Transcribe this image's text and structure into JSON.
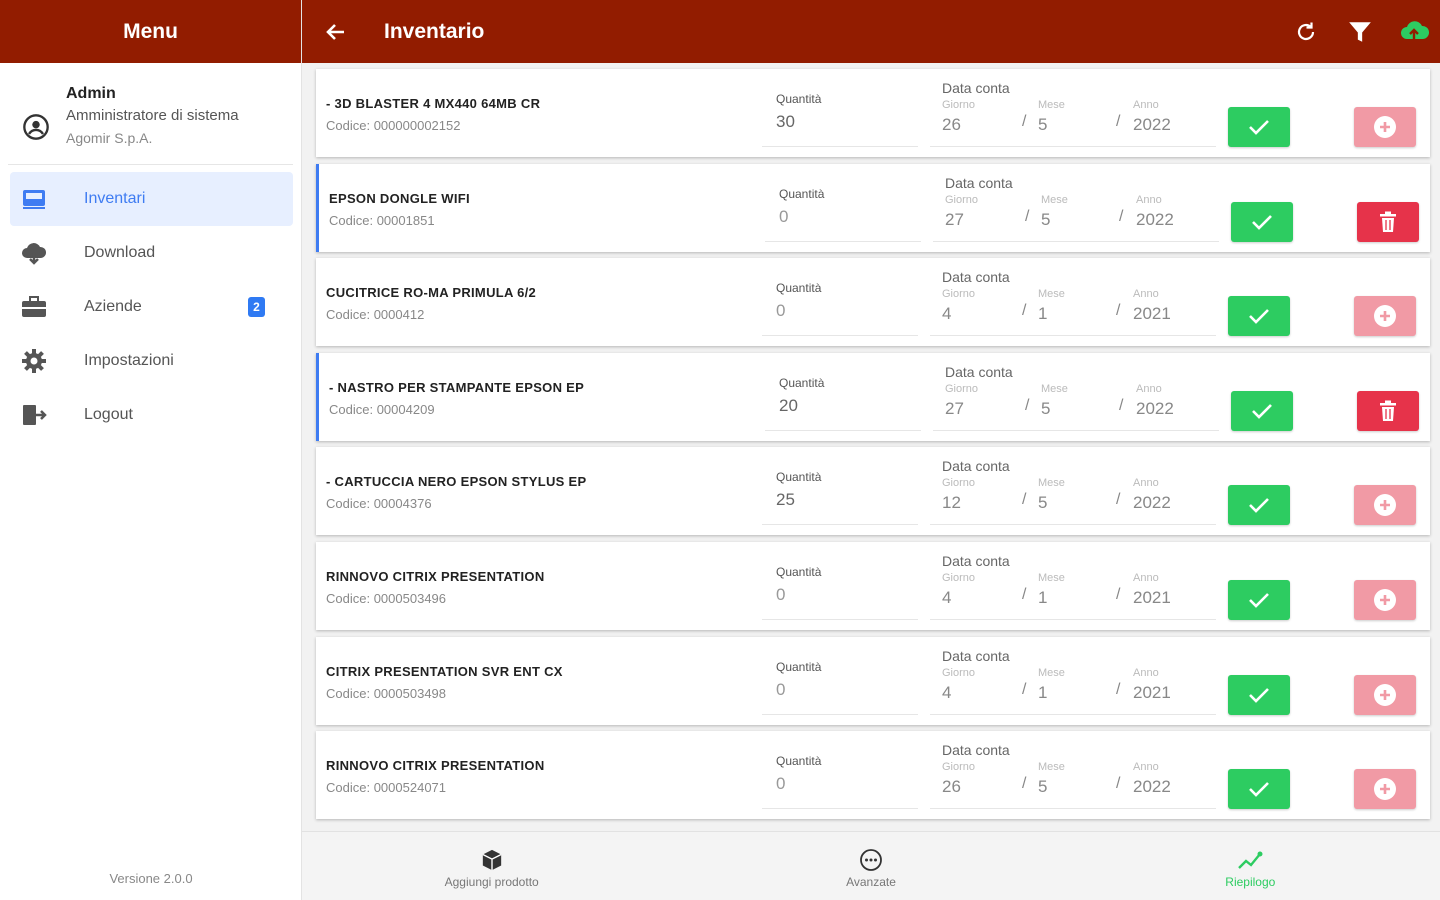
{
  "sidebar": {
    "title": "Menu",
    "profile": {
      "name": "Admin",
      "role": "Amministratore di sistema",
      "company": "Agomir S.p.A."
    },
    "items": [
      {
        "label": "Inventari",
        "icon": "inventory-icon",
        "active": true
      },
      {
        "label": "Download",
        "icon": "cloud-download-icon"
      },
      {
        "label": "Aziende",
        "icon": "briefcase-icon",
        "badge": "2"
      },
      {
        "label": "Impostazioni",
        "icon": "gear-icon"
      },
      {
        "label": "Logout",
        "icon": "logout-icon"
      }
    ],
    "version": "Versione 2.0.0"
  },
  "topbar": {
    "title": "Inventario",
    "actions": [
      "refresh-icon",
      "filter-icon",
      "cloud-upload-icon"
    ]
  },
  "labels": {
    "quantity": "Quantità",
    "date_title": "Data conta",
    "day": "Giorno",
    "month": "Mese",
    "year": "Anno",
    "code_prefix": "Codice:"
  },
  "items": [
    {
      "name": "- 3D BLASTER 4 MX440 64MB CR",
      "code": "000000002152",
      "qty": "30",
      "day": "26",
      "month": "5",
      "year": "2022",
      "marked": false,
      "delete_enabled": false
    },
    {
      "name": "EPSON DONGLE WIFI",
      "code": "00001851",
      "qty": "0",
      "day": "27",
      "month": "5",
      "year": "2022",
      "marked": true,
      "delete_enabled": true
    },
    {
      "name": "CUCITRICE RO-MA PRIMULA 6/2",
      "code": "0000412",
      "qty": "0",
      "day": "4",
      "month": "1",
      "year": "2021",
      "marked": false,
      "delete_enabled": false
    },
    {
      "name": "- NASTRO PER STAMPANTE EPSON EP",
      "code": "00004209",
      "qty": "20",
      "day": "27",
      "month": "5",
      "year": "2022",
      "marked": true,
      "delete_enabled": true
    },
    {
      "name": "- CARTUCCIA NERO EPSON STYLUS EP",
      "code": "00004376",
      "qty": "25",
      "day": "12",
      "month": "5",
      "year": "2022",
      "marked": false,
      "delete_enabled": false
    },
    {
      "name": "RINNOVO CITRIX PRESENTATION",
      "code": "0000503496",
      "qty": "0",
      "day": "4",
      "month": "1",
      "year": "2021",
      "marked": false,
      "delete_enabled": false
    },
    {
      "name": "CITRIX PRESENTATION SVR ENT CX",
      "code": "0000503498",
      "qty": "0",
      "day": "4",
      "month": "1",
      "year": "2021",
      "marked": false,
      "delete_enabled": false
    },
    {
      "name": "RINNOVO CITRIX PRESENTATION",
      "code": "0000524071",
      "qty": "0",
      "day": "26",
      "month": "5",
      "year": "2022",
      "marked": false,
      "delete_enabled": false
    }
  ],
  "bottom_tabs": [
    {
      "label": "Aggiungi prodotto",
      "icon": "box-icon",
      "active": false
    },
    {
      "label": "Avanzate",
      "icon": "more-circle-icon",
      "active": false
    },
    {
      "label": "Riepilogo",
      "icon": "trend-icon",
      "active": true
    }
  ],
  "colors": {
    "header": "#921c00",
    "accent": "#3f7cf2",
    "confirm": "#2dcc61",
    "delete": "#e6334a",
    "delete_disabled": "#f19aa5"
  }
}
